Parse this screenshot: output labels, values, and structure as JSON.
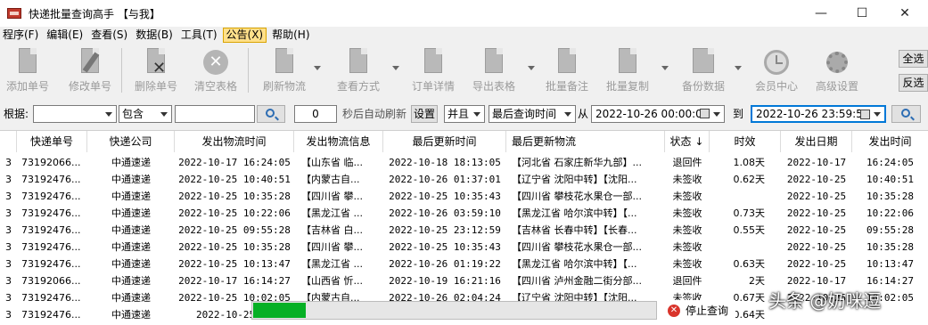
{
  "window": {
    "title": "快递批量查询高手 【与我】",
    "min_glyph": "—",
    "max_glyph": "☐",
    "close_glyph": "✕"
  },
  "menu": [
    "程序(F)",
    "编辑(E)",
    "查看(S)",
    "数据(B)",
    "工具(T)",
    "公告(X)",
    "帮助(H)"
  ],
  "menu_active_index": 5,
  "toolbar": {
    "add": "添加单号",
    "edit": "修改单号",
    "delete": "删除单号",
    "clear": "清空表格",
    "refresh": "刷新物流",
    "view": "查看方式",
    "detail": "订单详情",
    "export": "导出表格",
    "batch_note": "批量备注",
    "batch_copy": "批量复制",
    "backup": "备份数据",
    "member": "会员中心",
    "advanced": "高级设置",
    "select_all": "全选",
    "invert": "反选"
  },
  "filter": {
    "label": "根据:",
    "field_value": "",
    "match_mode": "包含",
    "keyword": "",
    "interval": "0",
    "auto_refresh_label": "秒后自动刷新",
    "set_button": "设置",
    "logic": "并且",
    "time_field": "最后查询时间",
    "from_label": "从",
    "from_value": "2022-10-26 00:00:00",
    "to_label": "到",
    "to_value": "2022-10-26 23:59:59"
  },
  "table": {
    "headers": [
      "快递单号",
      "快递公司",
      "发出物流时间",
      "发出物流信息",
      "最后更新时间",
      "最后更新物流",
      "状态",
      "时效",
      "发出日期",
      "发出时间"
    ],
    "sort_indicator": "↓",
    "rows": [
      {
        "idx": "3",
        "no": "73192066...",
        "co": "中通速递",
        "send_time": "2022-10-17 16:24:05",
        "send_info": "【山东省 临...",
        "upd_time": "2022-10-18 18:13:05",
        "upd_info": "【河北省 石家庄新华九部】...",
        "status": "退回件",
        "age": "1.08天",
        "date": "2022-10-17",
        "time": "16:24:05"
      },
      {
        "idx": "3",
        "no": "73192476...",
        "co": "中通速递",
        "send_time": "2022-10-25 10:40:51",
        "send_info": "【内蒙古自...",
        "upd_time": "2022-10-26 01:37:01",
        "upd_info": "【辽宁省 沈阳中转】【沈阳...",
        "status": "未签收",
        "age": "0.62天",
        "date": "2022-10-25",
        "time": "10:40:51"
      },
      {
        "idx": "3",
        "no": "73192476...",
        "co": "中通速递",
        "send_time": "2022-10-25 10:35:28",
        "send_info": "【四川省 攀...",
        "upd_time": "2022-10-25 10:35:43",
        "upd_info": "【四川省 攀枝花水果仓一部...",
        "status": "未签收",
        "age": "",
        "date": "2022-10-25",
        "time": "10:35:28"
      },
      {
        "idx": "3",
        "no": "73192476...",
        "co": "中通速递",
        "send_time": "2022-10-25 10:22:06",
        "send_info": "【黑龙江省 ...",
        "upd_time": "2022-10-26 03:59:10",
        "upd_info": "【黑龙江省 哈尔滨中转】【...",
        "status": "未签收",
        "age": "0.73天",
        "date": "2022-10-25",
        "time": "10:22:06"
      },
      {
        "idx": "3",
        "no": "73192476...",
        "co": "中通速递",
        "send_time": "2022-10-25 09:55:28",
        "send_info": "【吉林省 白...",
        "upd_time": "2022-10-25 23:12:59",
        "upd_info": "【吉林省 长春中转】【长春...",
        "status": "未签收",
        "age": "0.55天",
        "date": "2022-10-25",
        "time": "09:55:28"
      },
      {
        "idx": "3",
        "no": "73192476...",
        "co": "中通速递",
        "send_time": "2022-10-25 10:35:28",
        "send_info": "【四川省 攀...",
        "upd_time": "2022-10-25 10:35:43",
        "upd_info": "【四川省 攀枝花水果仓一部...",
        "status": "未签收",
        "age": "",
        "date": "2022-10-25",
        "time": "10:35:28"
      },
      {
        "idx": "3",
        "no": "73192476...",
        "co": "中通速递",
        "send_time": "2022-10-25 10:13:47",
        "send_info": "【黑龙江省 ...",
        "upd_time": "2022-10-26 01:19:22",
        "upd_info": "【黑龙江省 哈尔滨中转】【...",
        "status": "未签收",
        "age": "0.63天",
        "date": "2022-10-25",
        "time": "10:13:47"
      },
      {
        "idx": "3",
        "no": "73192066...",
        "co": "中通速递",
        "send_time": "2022-10-17 16:14:27",
        "send_info": "【山西省 忻...",
        "upd_time": "2022-10-19 16:21:16",
        "upd_info": "【四川省 泸州金融二街分部...",
        "status": "退回件",
        "age": "2天",
        "date": "2022-10-17",
        "time": "16:14:27"
      },
      {
        "idx": "3",
        "no": "73192476...",
        "co": "中通速递",
        "send_time": "2022-10-25 10:02:05",
        "send_info": "【内蒙古自...",
        "upd_time": "2022-10-26 02:04:24",
        "upd_info": "【辽宁省 沈阳中转】【沈阳...",
        "status": "未签收",
        "age": "0.67天",
        "date": "2022-10-25",
        "time": "10:02:05"
      },
      {
        "idx": "3",
        "no": "73192476...",
        "co": "中通速递",
        "send_time": "2022-10-25 10",
        "send_info": "",
        "upd_time": "",
        "upd_info": "",
        "status": "",
        "age": "0.64天",
        "date": "",
        "time": ""
      }
    ]
  },
  "progress": {
    "fraction": 0.13
  },
  "stop_button": "停止查询",
  "watermark": "头条 @奶咪逗",
  "colors": {
    "progress_green": "#06b025",
    "active_menu": "#ffe08a",
    "focus_border": "#0078d7"
  }
}
